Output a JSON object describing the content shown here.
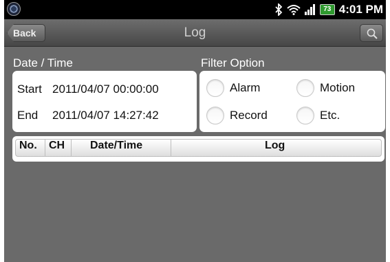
{
  "status_bar": {
    "app_icon": "camera-lens-icon",
    "icons": [
      "bluetooth-icon",
      "wifi-icon",
      "signal-icon"
    ],
    "battery_level": "73",
    "time": "4:01 PM"
  },
  "title_bar": {
    "back_label": "Back",
    "title": "Log",
    "search_icon": "magnifier-icon"
  },
  "date_time": {
    "section_label": "Date / Time",
    "start_label": "Start",
    "start_value": "2011/04/07 00:00:00",
    "end_label": "End",
    "end_value": "2011/04/07 14:27:42"
  },
  "filter": {
    "section_label": "Filter Option",
    "options": [
      {
        "label": "Alarm",
        "selected": false
      },
      {
        "label": "Motion",
        "selected": false
      },
      {
        "label": "Record",
        "selected": false
      },
      {
        "label": "Etc.",
        "selected": false
      }
    ]
  },
  "log_table": {
    "columns": [
      "No.",
      "CH",
      "Date/Time",
      "Log"
    ],
    "rows": []
  },
  "colors": {
    "background": "#6a6a6a",
    "title_bar": "#555555",
    "battery": "#2f9a2f"
  }
}
